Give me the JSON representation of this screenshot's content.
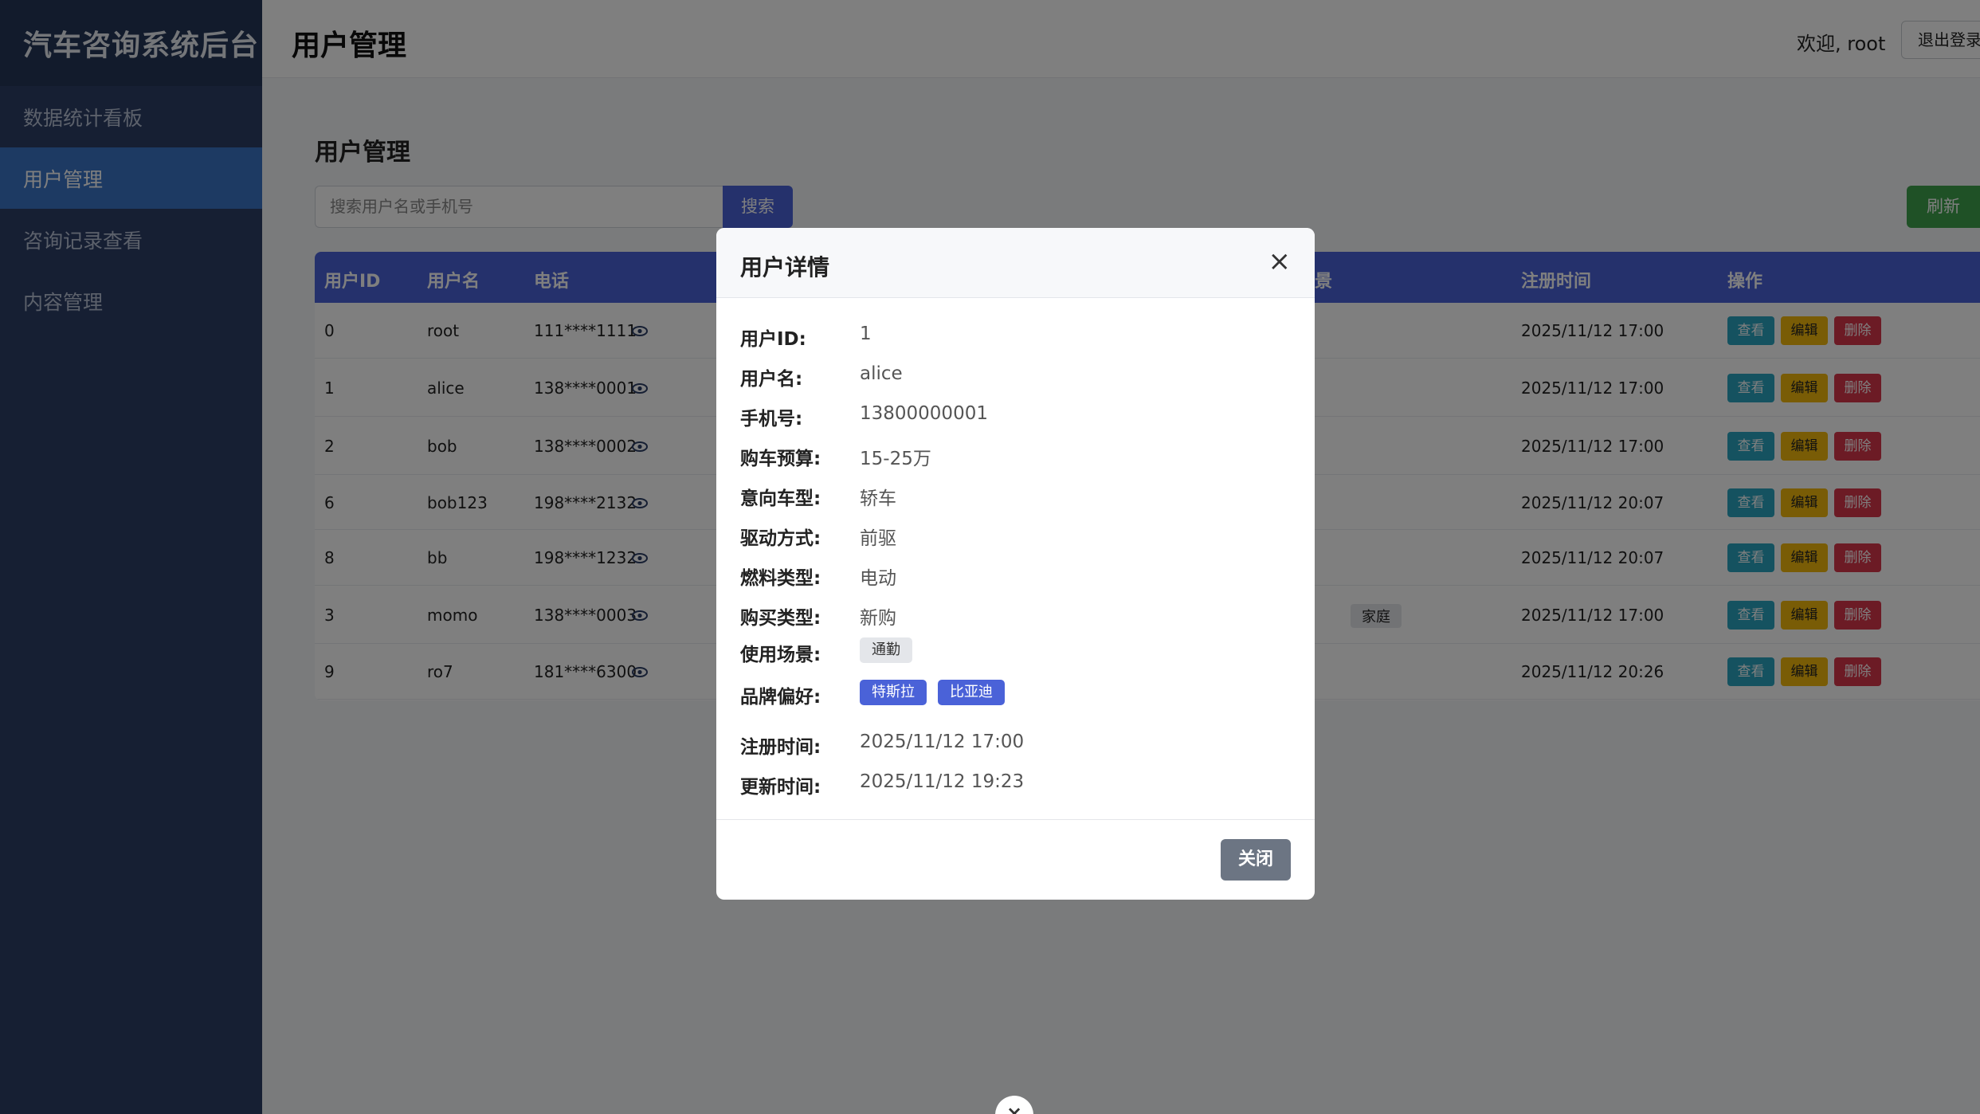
{
  "sidebar": {
    "brand": "汽车咨询系统后台",
    "items": [
      {
        "label": "数据统计看板"
      },
      {
        "label": "用户管理"
      },
      {
        "label": "咨询记录查看"
      },
      {
        "label": "内容管理"
      }
    ]
  },
  "topbar": {
    "title": "用户管理",
    "welcome": "欢迎, root",
    "logout": "退出登录"
  },
  "main": {
    "section_title": "用户管理",
    "search_placeholder": "搜索用户名或手机号",
    "search_button": "搜索",
    "refresh_button": "刷新"
  },
  "table": {
    "headers": [
      "用户ID",
      "用户名",
      "电话",
      "景",
      "注册时间",
      "操作"
    ],
    "rows": [
      {
        "id": "0",
        "name": "root",
        "phone": "111****1111",
        "partial": "",
        "time": "2025/11/12 17:00"
      },
      {
        "id": "1",
        "name": "alice",
        "phone": "138****0001",
        "partial": "",
        "time": "2025/11/12 17:00"
      },
      {
        "id": "2",
        "name": "bob",
        "phone": "138****0002",
        "partial": "",
        "time": "2025/11/12 17:00"
      },
      {
        "id": "6",
        "name": "bob123",
        "phone": "198****2132",
        "partial": "",
        "time": "2025/11/12 20:07"
      },
      {
        "id": "8",
        "name": "bb",
        "phone": "198****1232",
        "partial": "",
        "time": "2025/11/12 20:07"
      },
      {
        "id": "3",
        "name": "momo",
        "phone": "138****0003",
        "partial": "家庭",
        "time": "2025/11/12 17:00"
      },
      {
        "id": "9",
        "name": "ro7",
        "phone": "181****6300",
        "partial": "",
        "time": "2025/11/12 20:26"
      }
    ],
    "op_view": "查看",
    "op_edit": "编辑",
    "op_delete": "删除"
  },
  "modal": {
    "title": "用户详情",
    "close_x": "×",
    "fields": [
      {
        "label": "用户ID:",
        "value": "1"
      },
      {
        "label": "用户名:",
        "value": "alice"
      },
      {
        "label": "手机号:",
        "value": "13800000001"
      },
      {
        "label": "购车预算:",
        "value": "15-25万"
      },
      {
        "label": "意向车型:",
        "value": "轿车"
      },
      {
        "label": "驱动方式:",
        "value": "前驱"
      },
      {
        "label": "燃料类型:",
        "value": "电动"
      },
      {
        "label": "购买类型:",
        "value": "新购"
      }
    ],
    "scene_label": "使用场景:",
    "scene_tags": [
      "通勤"
    ],
    "brand_label": "品牌偏好:",
    "brand_tags": [
      "特斯拉",
      "比亚迪"
    ],
    "reg_label": "注册时间:",
    "reg_value": "2025/11/12 17:00",
    "upd_label": "更新时间:",
    "upd_value": "2025/11/12 19:23",
    "close_button": "关闭"
  },
  "bottom_close": "×"
}
